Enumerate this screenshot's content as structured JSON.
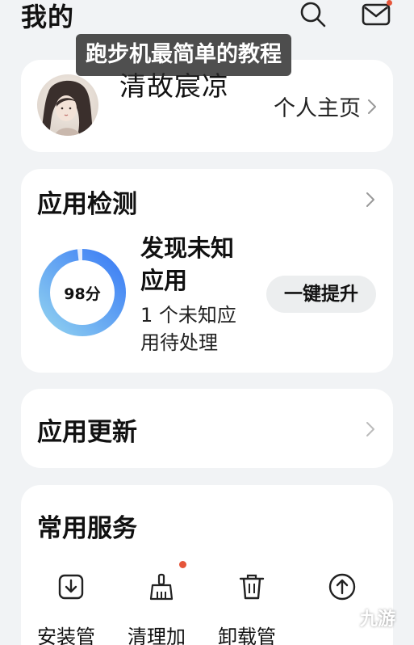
{
  "header": {
    "title": "我的",
    "search_icon": "search-icon",
    "mail_icon": "mail-icon",
    "mail_badge": "red-dot"
  },
  "overlay": {
    "caption": "跑步机最简单的教程"
  },
  "profile": {
    "username": "清故宸凉",
    "link_label": "个人主页"
  },
  "app_detect": {
    "title": "应用检测",
    "score": "98分",
    "score_fraction": 0.98,
    "status": "发现未知应用",
    "detail": "1 个未知应用待处理",
    "button_label": "一键提升"
  },
  "app_update": {
    "title": "应用更新"
  },
  "services": {
    "title": "常用服务",
    "items": [
      {
        "label": "安装管",
        "icon": "download-install-icon"
      },
      {
        "label": "清理加",
        "icon": "broom-clean-icon",
        "badge": true
      },
      {
        "label": "卸载管",
        "icon": "trash-uninstall-icon"
      },
      {
        "label": "",
        "icon": "upload-icon"
      }
    ]
  },
  "colors": {
    "background": "#f1f3f5",
    "card": "#ffffff",
    "ring_start": "#3b7cf5",
    "ring_end": "#8fd0f0",
    "badge": "#e5553a"
  },
  "watermark": {
    "text": "九游"
  }
}
